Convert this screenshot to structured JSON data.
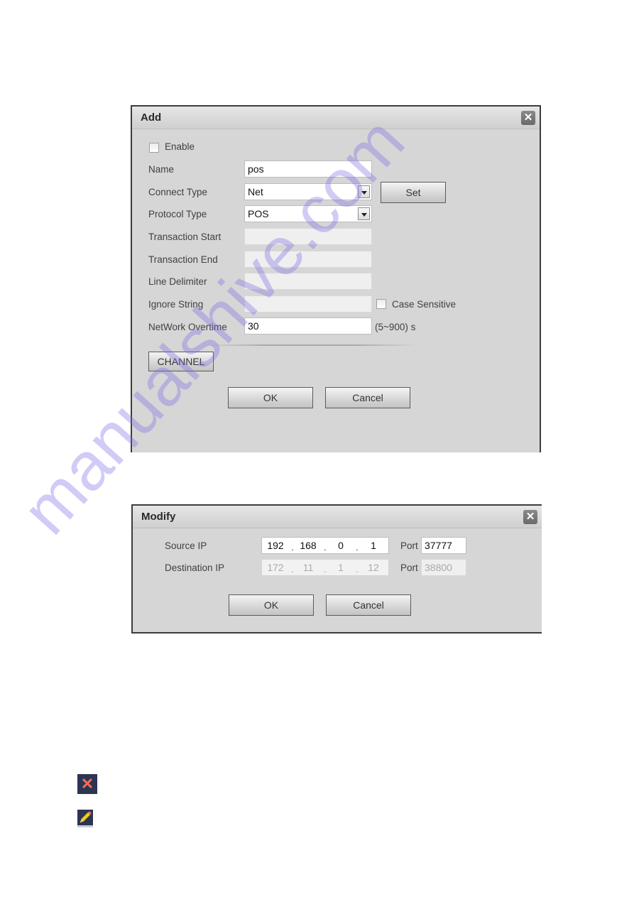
{
  "add_dialog": {
    "title": "Add",
    "close_icon": "close-icon",
    "enable_label": "Enable",
    "enable_checked": false,
    "fields": {
      "name": {
        "label": "Name",
        "value": "pos"
      },
      "connect_type": {
        "label": "Connect Type",
        "value": "Net"
      },
      "protocol_type": {
        "label": "Protocol Type",
        "value": "POS"
      },
      "transaction_start": {
        "label": "Transaction Start",
        "value": ""
      },
      "transaction_end": {
        "label": "Transaction End",
        "value": ""
      },
      "line_delimiter": {
        "label": "Line Delimiter",
        "value": ""
      },
      "ignore_string": {
        "label": "Ignore String",
        "value": ""
      },
      "network_overtime": {
        "label": "NetWork Overtime",
        "value": "30",
        "unit": "(5~900) s"
      }
    },
    "case_sensitive_label": "Case Sensitive",
    "case_sensitive_checked": false,
    "set_button": "Set",
    "channel_button": "CHANNEL",
    "ok_button": "OK",
    "cancel_button": "Cancel"
  },
  "modify_dialog": {
    "title": "Modify",
    "close_icon": "close-icon",
    "source_ip": {
      "label": "Source IP",
      "octets": [
        "192",
        "168",
        "0",
        "1"
      ],
      "port_label": "Port",
      "port": "37777"
    },
    "destination_ip": {
      "label": "Destination IP",
      "octets": [
        "172",
        "11",
        "1",
        "12"
      ],
      "port_label": "Port",
      "port": "38800"
    },
    "ok_button": "OK",
    "cancel_button": "Cancel"
  },
  "legend_icons": [
    {
      "icon": "delete-icon",
      "glyph": "✕",
      "color": "#ff6a55"
    },
    {
      "icon": "edit-pencil-icon",
      "color": "#f2d21e"
    }
  ],
  "watermark": "manualshive.com"
}
